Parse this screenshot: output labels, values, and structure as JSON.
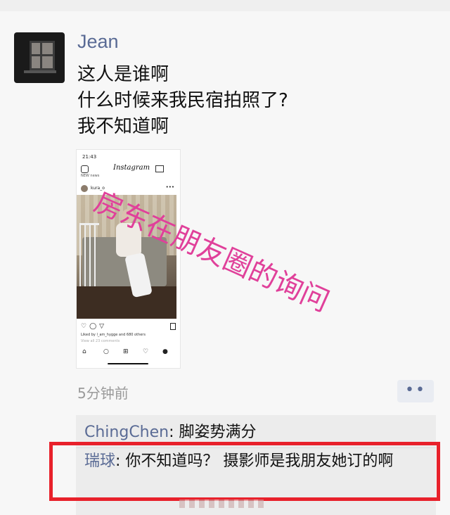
{
  "post": {
    "author": "Jean",
    "lines": [
      "这人是谁啊",
      "什么时候来我民宿拍照了?",
      "我不知道啊"
    ],
    "time_ago": "5分钟前",
    "more_label": "••"
  },
  "screenshot": {
    "clock": "21:43",
    "app_name": "Instagram",
    "new_label": "NEW news",
    "username": "kura_o",
    "likes_text": "Liked by l_am_hygge and 680 others",
    "comments_text": "View all 23 comments",
    "icons": [
      "heart-icon",
      "comment-icon",
      "send-icon",
      "bookmark-icon",
      "home-icon",
      "search-icon",
      "add-icon",
      "heart-icon",
      "profile-icon"
    ]
  },
  "overlay_caption": "房东在朋友圈的询问",
  "comments": [
    {
      "name": "ChingChen",
      "sep": ": ",
      "text": "脚姿势满分"
    },
    {
      "name": "瑞球",
      "sep": ": ",
      "text": "你不知道吗？ 摄影师是我朋友她订的啊"
    }
  ],
  "colors": {
    "link": "#5a6b95",
    "highlight": "#e8212b",
    "overlay_text": "#e0409a"
  }
}
